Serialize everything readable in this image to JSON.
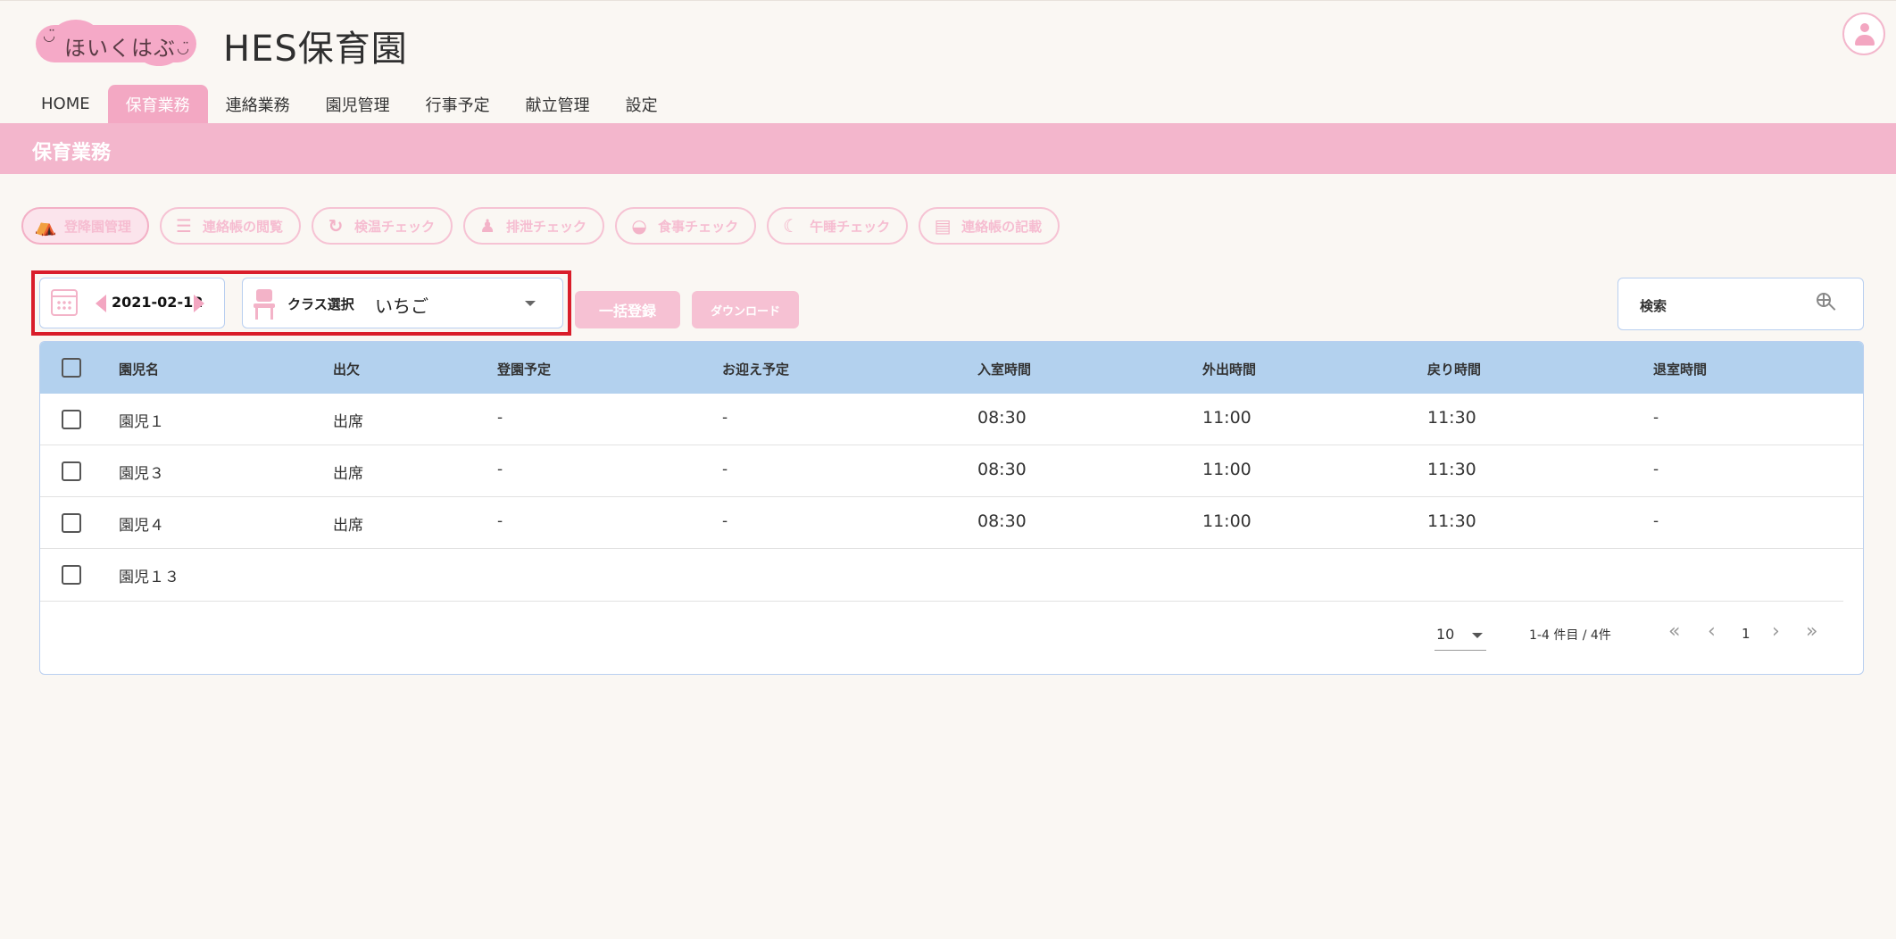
{
  "app": {
    "logo_text": "ほいくはぶ",
    "site_title": "HES保育園"
  },
  "nav": {
    "tabs": [
      {
        "label": "HOME",
        "active": false
      },
      {
        "label": "保育業務",
        "active": true
      },
      {
        "label": "連絡業務",
        "active": false
      },
      {
        "label": "園児管理",
        "active": false
      },
      {
        "label": "行事予定",
        "active": false
      },
      {
        "label": "献立管理",
        "active": false
      },
      {
        "label": "設定",
        "active": false
      }
    ]
  },
  "section": {
    "title": "保育業務"
  },
  "submenu": [
    {
      "label": "登降園管理",
      "icon": "arch-icon",
      "active": true
    },
    {
      "label": "連絡帳の閲覧",
      "icon": "list-icon",
      "active": false
    },
    {
      "label": "検温チェック",
      "icon": "thermometer-icon",
      "active": false
    },
    {
      "label": "排泄チェック",
      "icon": "duck-icon",
      "active": false
    },
    {
      "label": "食事チェック",
      "icon": "bowl-icon",
      "active": false
    },
    {
      "label": "午睡チェック",
      "icon": "moon-icon",
      "active": false
    },
    {
      "label": "連絡帳の記載",
      "icon": "notebook-icon",
      "active": false
    }
  ],
  "toolbar": {
    "date": "2021-02-12",
    "class_label": "クラス選択",
    "class_value": "いちご",
    "bulk_register": "一括登録",
    "download": "ダウンロード",
    "search_placeholder": "検索"
  },
  "table": {
    "headers": [
      "園児名",
      "出欠",
      "登園予定",
      "お迎え予定",
      "入室時間",
      "外出時間",
      "戻り時間",
      "退室時間"
    ],
    "rows": [
      [
        "園児１",
        "出席",
        "-",
        "-",
        "08:30",
        "11:00",
        "11:30",
        "-"
      ],
      [
        "園児３",
        "出席",
        "-",
        "-",
        "08:30",
        "11:00",
        "11:30",
        "-"
      ],
      [
        "園児４",
        "出席",
        "-",
        "-",
        "08:30",
        "11:00",
        "11:30",
        "-"
      ],
      [
        "園児１３",
        "",
        "",
        "",
        "",
        "",
        "",
        ""
      ]
    ]
  },
  "pagination": {
    "per_page": "10",
    "range": "1-4 件目 / 4件",
    "page": "1",
    "first": "«",
    "prev": "‹",
    "next": "›",
    "last": "»"
  },
  "colors": {
    "accent_pink": "#f3a8c3",
    "band_pink": "#f3b6cc",
    "header_blue": "#b3d1ee",
    "highlight_red": "#d91d2a"
  }
}
